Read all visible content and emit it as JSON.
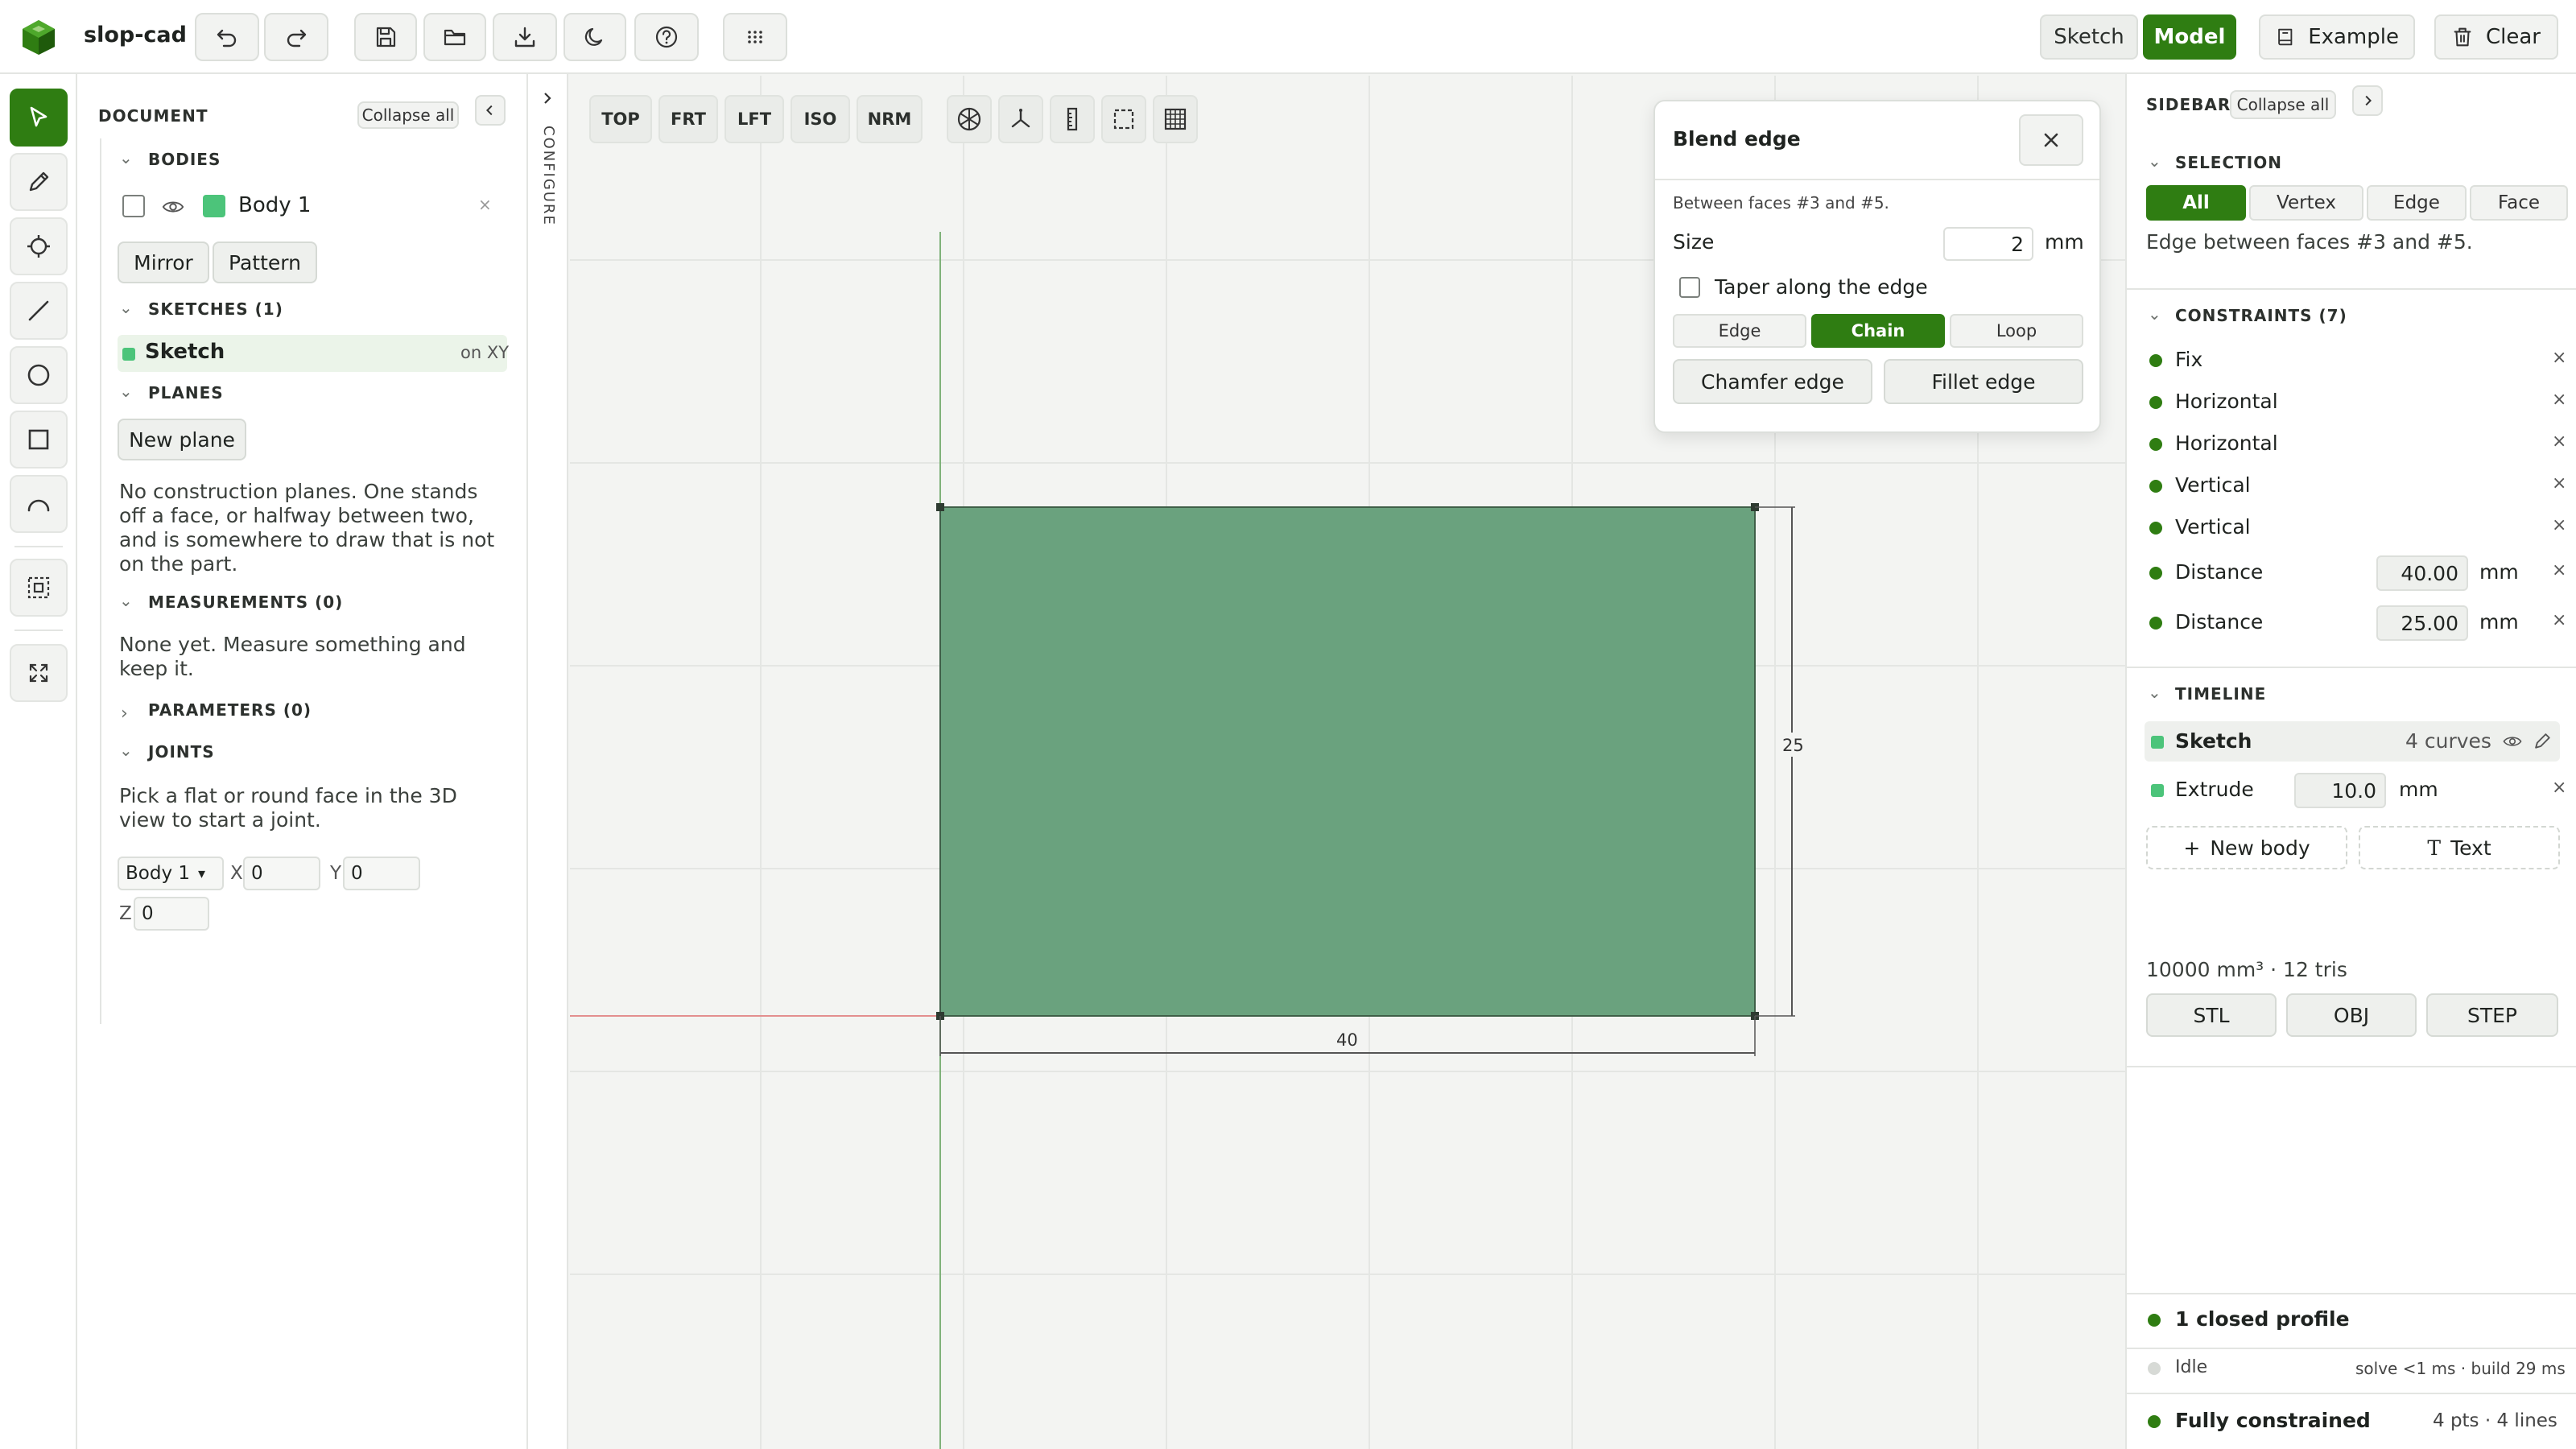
{
  "app": {
    "title": "slop-cad"
  },
  "modes": {
    "sketch": "Sketch",
    "model": "Model"
  },
  "topright": {
    "example": "Example",
    "clear": "Clear"
  },
  "document": {
    "heading": "DOCUMENT",
    "collapse_all": "Collapse all",
    "bodies": {
      "heading": "BODIES",
      "items": [
        {
          "name": "Body 1",
          "color": "#4cc47a"
        }
      ]
    },
    "body_actions": {
      "mirror": "Mirror",
      "pattern": "Pattern"
    },
    "sketches": {
      "heading": "SKETCHES (1)",
      "items": [
        {
          "name": "Sketch",
          "plane": "on XY"
        }
      ]
    },
    "planes": {
      "heading": "PLANES",
      "new_plane": "New plane",
      "empty": "No construction planes. One stands off a face, or halfway between two, and is somewhere to draw that is not on the part."
    },
    "measurements": {
      "heading": "MEASUREMENTS (0)",
      "empty": "None yet. Measure something and keep it."
    },
    "parameters": {
      "heading": "PARAMETERS (0)"
    },
    "joints": {
      "heading": "JOINTS",
      "hint": "Pick a flat or round face in the 3D view to start a joint.",
      "body_select": "Body 1",
      "x_label": "X",
      "x_value": "0",
      "y_label": "Y",
      "y_value": "0",
      "z_label": "Z",
      "z_value": "0"
    }
  },
  "configure": {
    "label": "CONFIGURE"
  },
  "view_buttons": [
    "TOP",
    "FRT",
    "LFT",
    "ISO",
    "NRM"
  ],
  "sketch_view": {
    "width_label": "40",
    "height_label": "25",
    "fill": "#6aa27e"
  },
  "blend": {
    "title": "Blend edge",
    "subtitle": "Between faces #3 and #5.",
    "size_label": "Size",
    "size_value": "2",
    "size_unit": "mm",
    "taper_label": "Taper along the edge",
    "modes": [
      "Edge",
      "Chain",
      "Loop"
    ],
    "active_mode": "Chain",
    "chamfer": "Chamfer edge",
    "fillet": "Fillet edge"
  },
  "sidebar": {
    "heading": "SIDEBAR",
    "collapse_all": "Collapse all",
    "selection": {
      "heading": "SELECTION",
      "filters": [
        "All",
        "Vertex",
        "Edge",
        "Face"
      ],
      "active_filter": "All",
      "description": "Edge between faces #3 and #5."
    },
    "constraints": {
      "heading": "CONSTRAINTS (7)",
      "items": [
        {
          "name": "Fix"
        },
        {
          "name": "Horizontal"
        },
        {
          "name": "Horizontal"
        },
        {
          "name": "Vertical"
        },
        {
          "name": "Vertical"
        },
        {
          "name": "Distance",
          "value": "40.00",
          "unit": "mm"
        },
        {
          "name": "Distance",
          "value": "25.00",
          "unit": "mm"
        }
      ]
    },
    "timeline": {
      "heading": "TIMELINE",
      "items": [
        {
          "name": "Sketch",
          "detail": "4 curves"
        },
        {
          "name": "Extrude",
          "value": "10.0",
          "unit": "mm"
        }
      ],
      "new_body": "New body",
      "text": "Text",
      "stats": "10000 mm³ · 12 tris",
      "exports": [
        "STL",
        "OBJ",
        "STEP"
      ]
    },
    "status": {
      "profile": "1 closed profile",
      "idle": "Idle",
      "timing": "solve <1 ms · build 29 ms",
      "constrained": "Fully constrained",
      "counts": "4 pts · 4 lines"
    }
  },
  "colors": {
    "accent": "#2f7d12",
    "body": "#4cc47a"
  }
}
